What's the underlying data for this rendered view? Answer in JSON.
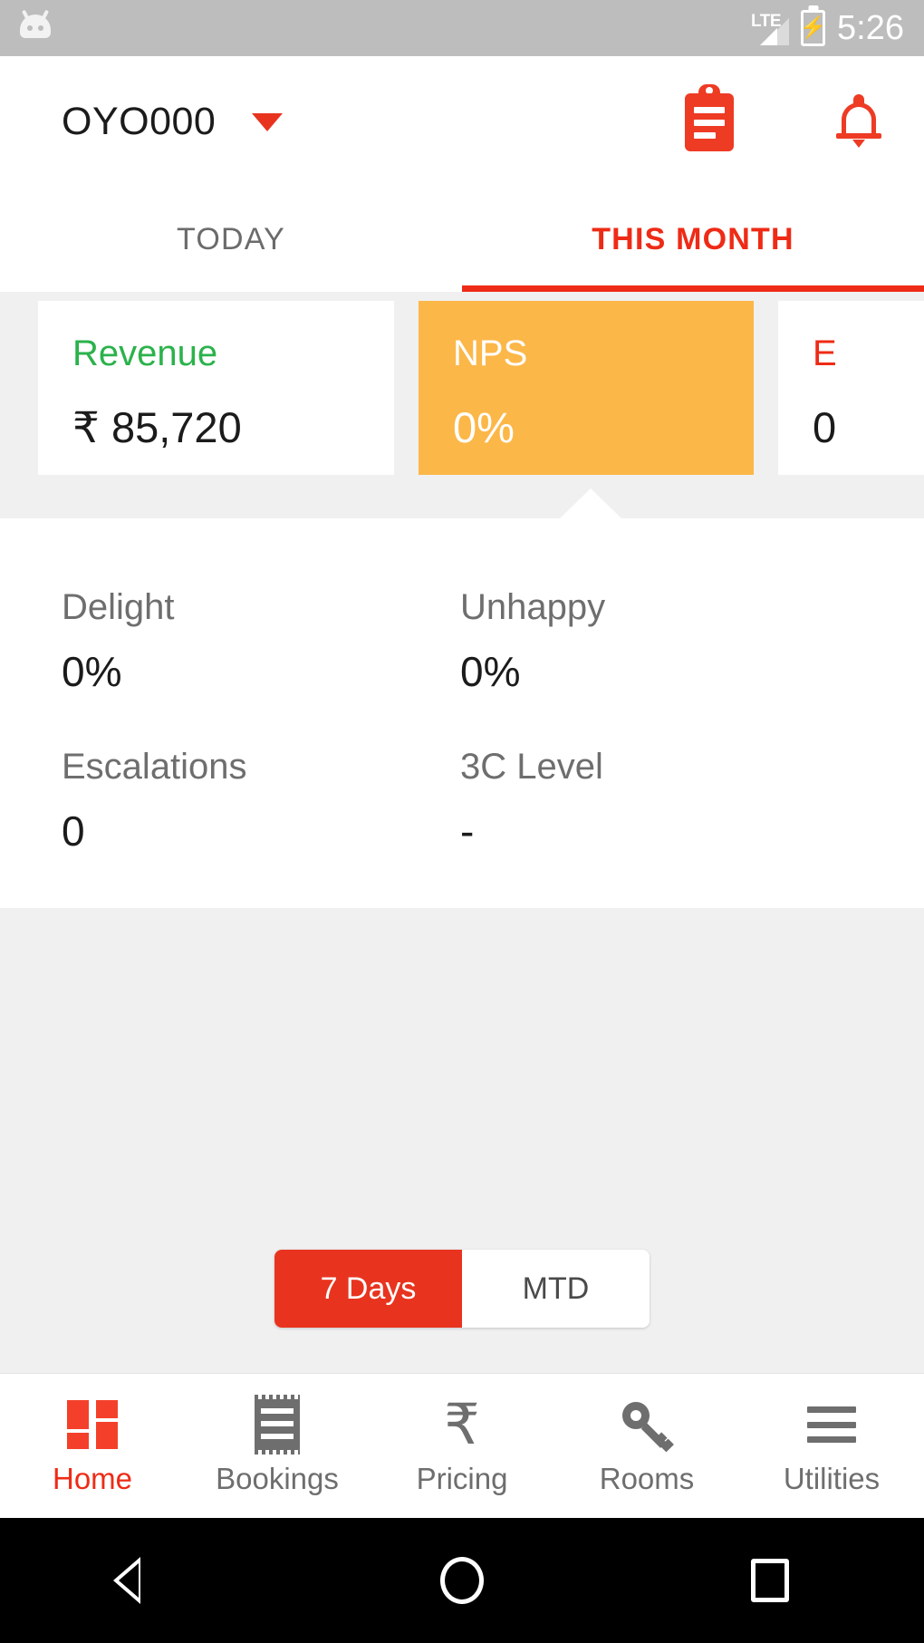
{
  "status_bar": {
    "network_label": "LTE",
    "time": "5:26",
    "battery_state": "charging",
    "android_icon": "android-head-icon"
  },
  "app_header": {
    "hotel_id": "OYO000",
    "dropdown_icon": "chevron-down-icon",
    "clipboard_icon": "clipboard-icon",
    "notification_icon": "bell-icon"
  },
  "tabs": {
    "items": [
      {
        "label": "TODAY",
        "active": false
      },
      {
        "label": "THIS MONTH",
        "active": true
      }
    ]
  },
  "metric_cards": [
    {
      "title": "Revenue",
      "value": "₹ 85,720",
      "style": "white",
      "title_color": "#2bb24c"
    },
    {
      "title": "NPS",
      "value": "0%",
      "style": "selected",
      "bg_color": "#fcb749"
    },
    {
      "title": "E",
      "value": "0",
      "style": "white",
      "title_color": "#ee2b16"
    }
  ],
  "details": {
    "rows": [
      [
        {
          "label": "Delight",
          "value": "0%"
        },
        {
          "label": "Unhappy",
          "value": "0%"
        }
      ],
      [
        {
          "label": "Escalations",
          "value": "0"
        },
        {
          "label": "3C Level",
          "value": "-"
        }
      ]
    ]
  },
  "range_toggle": {
    "options": [
      {
        "label": "7 Days",
        "active": true
      },
      {
        "label": "MTD",
        "active": false
      }
    ]
  },
  "bottom_nav": {
    "items": [
      {
        "label": "Home",
        "icon": "grid-icon",
        "active": true
      },
      {
        "label": "Bookings",
        "icon": "receipt-icon",
        "active": false
      },
      {
        "label": "Pricing",
        "icon": "rupee-icon",
        "active": false
      },
      {
        "label": "Rooms",
        "icon": "key-icon",
        "active": false
      },
      {
        "label": "Utilities",
        "icon": "hamburger-icon",
        "active": false
      }
    ]
  },
  "system_nav": {
    "back_icon": "triangle-back-icon",
    "home_icon": "circle-home-icon",
    "recents_icon": "square-recents-icon"
  },
  "colors": {
    "brand_red": "#ee2b16",
    "accent_orange": "#fcb749",
    "revenue_green": "#2bb24c",
    "page_bg": "#f0f0f0"
  },
  "glyphs": {
    "rupee": "₹",
    "bolt": "⚡"
  }
}
